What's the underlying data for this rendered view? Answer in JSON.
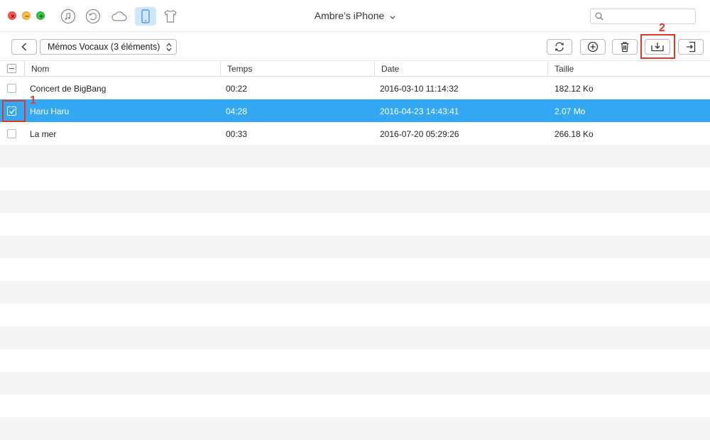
{
  "window": {
    "device_title": "Ambre’s iPhone",
    "search_placeholder": ""
  },
  "nav_icons": [
    "music-icon",
    "restore-icon",
    "cloud-icon",
    "phone-icon",
    "tshirt-icon"
  ],
  "toolbar": {
    "category_select": "Mémos Vocaux (3 éléments)"
  },
  "annotations": {
    "step1": "1",
    "step2": "2"
  },
  "table": {
    "columns": [
      "Nom",
      "Temps",
      "Date",
      "Taille"
    ],
    "rows": [
      {
        "name": "Concert de BigBang",
        "time": "00:22",
        "date": "2016-03-10 11:14:32",
        "size": "182.12 Ko",
        "selected": false
      },
      {
        "name": "Haru Haru",
        "time": "04:28",
        "date": "2016-04-23 14:43:41",
        "size": "2.07 Mo",
        "selected": true
      },
      {
        "name": "La mer",
        "time": "00:33",
        "date": "2016-07-20 05:29:26",
        "size": "266.18 Ko",
        "selected": false
      }
    ]
  },
  "colors": {
    "selection": "#35a8f4",
    "highlight": "#e8332a",
    "active_nav": "#cfe6fb"
  }
}
